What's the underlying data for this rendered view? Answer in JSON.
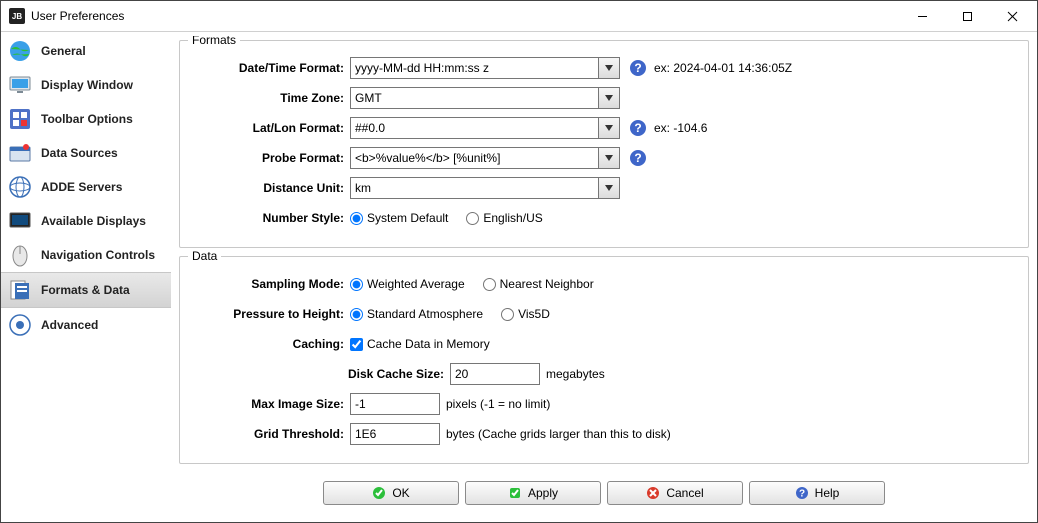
{
  "window": {
    "title": "User Preferences"
  },
  "sidebar": {
    "items": [
      {
        "label": "General"
      },
      {
        "label": "Display Window"
      },
      {
        "label": "Toolbar Options"
      },
      {
        "label": "Data Sources"
      },
      {
        "label": "ADDE Servers"
      },
      {
        "label": "Available Displays"
      },
      {
        "label": "Navigation Controls"
      },
      {
        "label": "Formats & Data"
      },
      {
        "label": "Advanced"
      }
    ],
    "selected_index": 7
  },
  "formats": {
    "legend": "Formats",
    "datetime": {
      "label": "Date/Time Format:",
      "value": "yyyy-MM-dd HH:mm:ss z",
      "example_prefix": "ex:",
      "example": "2024-04-01 14:36:05Z"
    },
    "timezone": {
      "label": "Time Zone:",
      "value": "GMT"
    },
    "latlon": {
      "label": "Lat/Lon Format:",
      "value": "##0.0",
      "example_prefix": "ex:",
      "example": "-104.6"
    },
    "probe": {
      "label": "Probe Format:",
      "value": "<b>%value%</b> [%unit%]"
    },
    "distance": {
      "label": "Distance Unit:",
      "value": "km"
    },
    "numstyle": {
      "label": "Number Style:",
      "options": [
        "System Default",
        "English/US"
      ],
      "selected": 0
    }
  },
  "data": {
    "legend": "Data",
    "sampling": {
      "label": "Sampling Mode:",
      "options": [
        "Weighted Average",
        "Nearest Neighbor"
      ],
      "selected": 0
    },
    "pressure": {
      "label": "Pressure to Height:",
      "options": [
        "Standard Atmosphere",
        "Vis5D"
      ],
      "selected": 0
    },
    "caching": {
      "label": "Caching:",
      "checkbox_label": "Cache Data in Memory",
      "checked": true
    },
    "diskcache": {
      "label": "Disk Cache Size:",
      "value": "20",
      "suffix": "megabytes"
    },
    "maximg": {
      "label": "Max Image Size:",
      "value": "-1",
      "suffix": "pixels (-1 = no limit)"
    },
    "gridthresh": {
      "label": "Grid Threshold:",
      "value": "1E6",
      "suffix": "bytes (Cache grids larger than this to disk)"
    }
  },
  "buttons": {
    "ok": "OK",
    "apply": "Apply",
    "cancel": "Cancel",
    "help": "Help"
  }
}
